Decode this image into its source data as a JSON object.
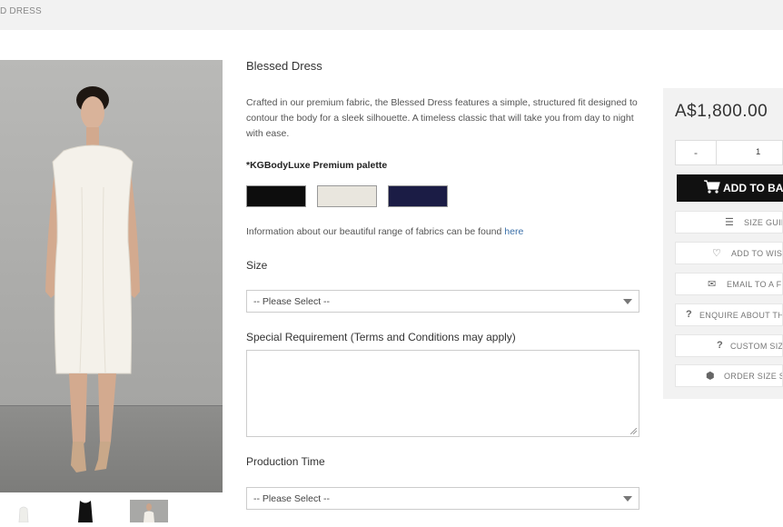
{
  "breadcrumb": "D DRESS",
  "product": {
    "title": "Blessed Dress",
    "description": "Crafted in our premium fabric, the Blessed Dress features a simple, structured fit designed to contour the body for a sleek silhouette. A timeless classic that will take you from day to night with ease.",
    "palette_label": "*KGBodyLuxe Premium palette",
    "swatches": [
      {
        "name": "black",
        "color": "#0d0d0d"
      },
      {
        "name": "cream",
        "color": "#e9e6de"
      },
      {
        "name": "navy",
        "color": "#1b1c45"
      }
    ],
    "fabric_info_text": "Information about our beautiful range of fabrics can be found ",
    "fabric_info_link": "here",
    "size_label": "Size",
    "size_selected": "-- Please Select --",
    "special_label": "Special Requirement (Terms and Conditions may apply)",
    "special_value": "",
    "production_label": "Production Time",
    "production_selected": "-- Please Select --"
  },
  "buy_panel": {
    "price": "A$1,800.00",
    "qty_minus": "-",
    "qty_value": "1",
    "add_to_basket": "ADD TO BASKET",
    "actions": [
      {
        "icon": "list-icon",
        "glyph": "☰",
        "label": "SIZE GUIDE"
      },
      {
        "icon": "heart-icon",
        "glyph": "♡",
        "label": "ADD TO WISHLIST"
      },
      {
        "icon": "envelope-icon",
        "glyph": "✉",
        "label": "EMAIL TO A FRIEND"
      },
      {
        "icon": "question-icon",
        "glyph": "?",
        "label": "ENQUIRE ABOUT THIS"
      },
      {
        "icon": "question-icon",
        "glyph": "?",
        "label": "CUSTOM SIZING"
      },
      {
        "icon": "hexagon-icon",
        "glyph": "⬢",
        "label": "ORDER SIZE SAMPLE"
      }
    ]
  },
  "colors": {
    "panel_bg": "#f2f2f2",
    "button_bg": "#111111",
    "link": "#3a6fa8"
  }
}
